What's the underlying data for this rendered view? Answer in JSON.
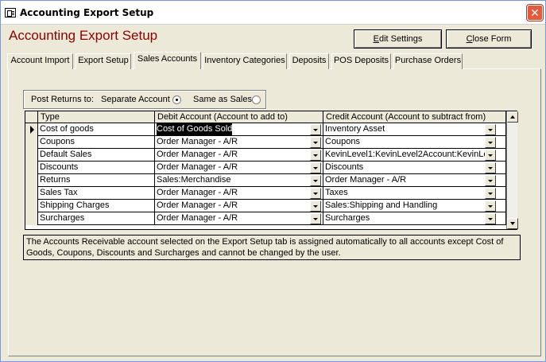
{
  "window": {
    "title": "Accounting Export Setup",
    "close_glyph": "✕"
  },
  "form": {
    "title": "Accounting Export Setup",
    "edit_settings_prefix": "E",
    "edit_settings_rest": "dit Settings",
    "close_form_prefix": "C",
    "close_form_rest": "lose Form"
  },
  "tabs": [
    {
      "label": "Account Import"
    },
    {
      "label": "Export Setup"
    },
    {
      "label": "Sales Accounts",
      "active": true
    },
    {
      "label": "Inventory Categories"
    },
    {
      "label": "Deposits"
    },
    {
      "label": "POS Deposits"
    },
    {
      "label": "Purchase Orders"
    }
  ],
  "returns": {
    "label": "Post Returns to:",
    "option_separate": "Separate Account",
    "option_same": "Same as Sales",
    "selected": "Separate Account"
  },
  "grid": {
    "columns": [
      "Type",
      "Debit Account (Account to add to)",
      "Credit Account (Account to subtract from)"
    ],
    "rows": [
      {
        "type": "Cost of goods",
        "debit": "Cost of Goods Sold",
        "credit": "Inventory Asset",
        "current": true
      },
      {
        "type": "Coupons",
        "debit": "Order Manager - A/R",
        "credit": "Coupons"
      },
      {
        "type": "Default Sales",
        "debit": "Order Manager - A/R",
        "credit": "KevinLevel1:KevinLevel2Account:KevinLe"
      },
      {
        "type": "Discounts",
        "debit": "Order Manager - A/R",
        "credit": "Discounts"
      },
      {
        "type": "Returns",
        "debit": "Sales:Merchandise",
        "credit": "Order Manager - A/R"
      },
      {
        "type": "Sales Tax",
        "debit": "Order Manager - A/R",
        "credit": "Taxes"
      },
      {
        "type": "Shipping Charges",
        "debit": "Order Manager - A/R",
        "credit": "Sales:Shipping and Handling"
      },
      {
        "type": "Surcharges",
        "debit": "Order Manager - A/R",
        "credit": "Surcharges"
      }
    ]
  },
  "note": "The Accounts Receivable account selected on the Export Setup tab is assigned automatically to all accounts except Cost of Goods, Coupons, Discounts and Surcharges and cannot be changed by the user.",
  "icons": {
    "app": "form-icon",
    "close": "close-icon",
    "dropdown": "chevron-down-icon",
    "record_selector": "record-pointer-icon"
  }
}
